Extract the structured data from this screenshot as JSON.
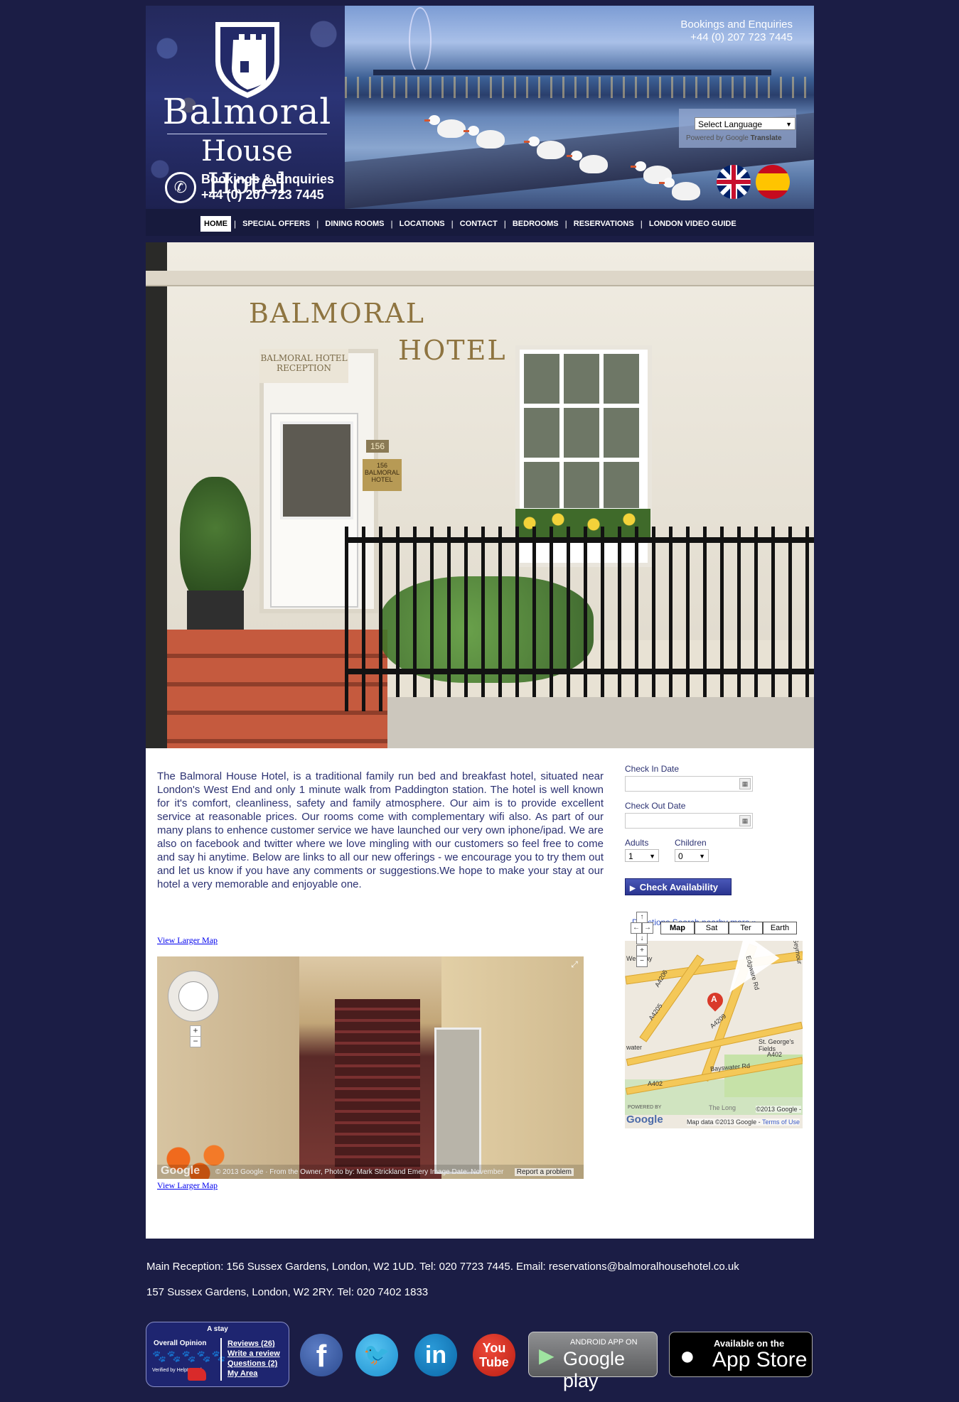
{
  "header": {
    "brand_line1": "Balmoral",
    "brand_line2": "House Hotel",
    "logo_bookings_label": "Bookings & Enquiries",
    "logo_phone": "+44 (0) 207 723 7445",
    "enquiries_label": "Bookings and Enquiries",
    "enquiries_phone": "+44 (0) 207 723 7445",
    "translate": {
      "select_label": "Select Language",
      "powered_by": "Powered by",
      "google": "Google",
      "translate": "Translate"
    },
    "flags": [
      "uk-flag-icon",
      "spain-flag-icon"
    ]
  },
  "nav": {
    "items": [
      {
        "label": "HOME",
        "active": true
      },
      {
        "label": "SPECIAL OFFERS"
      },
      {
        "label": "DINING ROOMS"
      },
      {
        "label": "LOCATIONS"
      },
      {
        "label": "CONTACT"
      },
      {
        "label": "BEDROOMS"
      },
      {
        "label": "RESERVATIONS"
      },
      {
        "label": "LONDON VIDEO GUIDE"
      }
    ]
  },
  "hero": {
    "sign_main": "BALMORAL",
    "sign_hotel": "HOTEL",
    "reception_sign": "BALMORAL HOTEL RECEPTION",
    "house_number": "156",
    "plaque": "156 BALMORAL HOTEL"
  },
  "main": {
    "intro": "The Balmoral House Hotel, is a traditional family run bed and breakfast hotel, situated near London's West End and only 1 minute walk from Paddington station. The hotel is well known for it's comfort, cleanliness, safety and family atmosphere. Our aim is to provide excellent service at reasonable prices. Our rooms come with complementary wifi also. As part of our many plans to enhence customer service we have launched our very own iphone/ipad. We are also on facebook and twitter where we love mingling with our customers so feel free to come and say hi anytime. Below are links to all our new offerings - we encourage you to try them out and let us know if you have any comments or suggestions.We hope to make your stay at our hotel a very memorable and enjoyable one.",
    "view_larger_map": "View Larger Map",
    "streetview": {
      "google": "Google",
      "credit": "© 2013 Google · From the Owner, Photo by: Mark Strickland Emery     Image Date: November",
      "report": "Report a problem"
    }
  },
  "booking": {
    "check_in_label": "Check In Date",
    "check_out_label": "Check Out Date",
    "adults_label": "Adults",
    "children_label": "Children",
    "adults_value": "1",
    "children_value": "0",
    "button_label": "Check Availability"
  },
  "minimap": {
    "links": "Directions  Search nearby  more »",
    "types": [
      "Map",
      "Sat",
      "Ter",
      "Earth"
    ],
    "labels": {
      "westway": "Westway",
      "a4206": "A4206",
      "a4205": "A4205",
      "a4209": "A4209",
      "a402_1": "A402",
      "a402_2": "A402",
      "bayswater": "Bayswater Rd",
      "st_georges": "St. George's Fields",
      "edgware_rd": "Edgware Rd",
      "water": "water",
      "seymour": "Seymour",
      "the_long": "The Long"
    },
    "pin": "A",
    "powered": "POWERED BY",
    "google": "Google",
    "copyright": "©2013 Google -",
    "map_data": "Map data ©2013 Google -",
    "terms": "Terms of Use"
  },
  "footer": {
    "line1": "Main Reception: 156 Sussex Gardens, London, W2 1UD. Tel: 020 7723 7445. Email: reservations@balmoralhousehotel.co.uk",
    "line2": "157 Sussex Gardens, London, W2 2RY. Tel: 020 7402 1833",
    "helphound": {
      "title": "A stay",
      "overall": "Overall Opinion",
      "verified": "Verified by HelpHound",
      "reviews": "Reviews (26)",
      "write": "Write a review",
      "questions": "Questions (2)",
      "my_area": "My Area"
    },
    "social": {
      "facebook": "f",
      "twitter": "🐦",
      "linkedin": "in",
      "youtube_you": "You",
      "youtube_tube": "Tube"
    },
    "google_play": {
      "small": "ANDROID APP ON",
      "big": "Google play"
    },
    "app_store": {
      "small": "Available on the",
      "big": "App Store"
    }
  }
}
